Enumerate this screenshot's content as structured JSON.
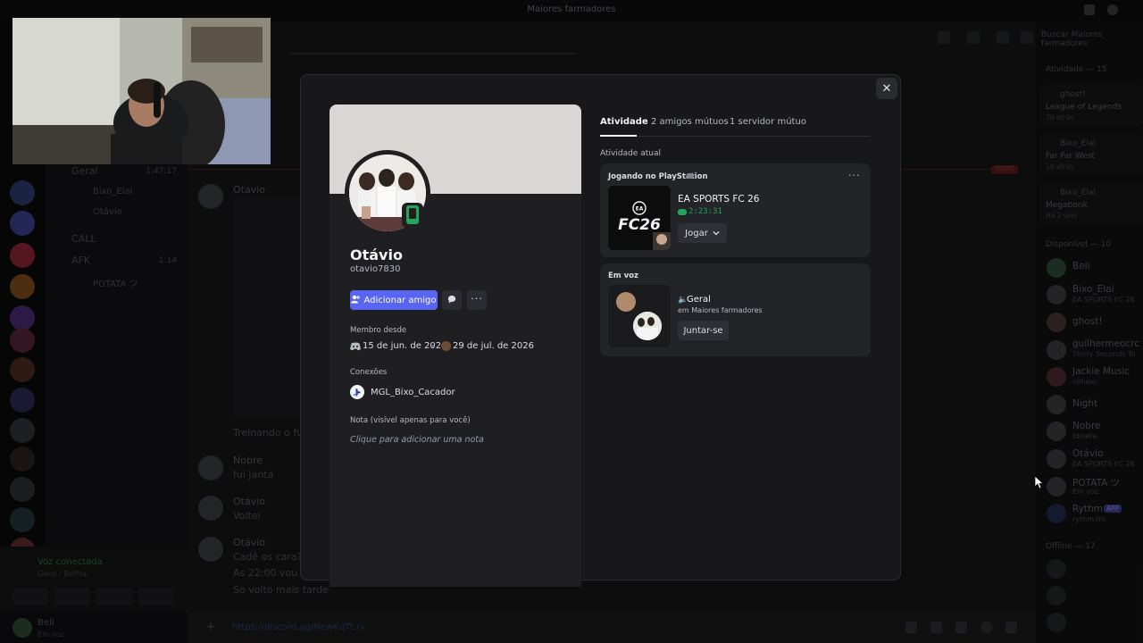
{
  "window": {
    "title": "Maiores farmadores"
  },
  "channels": [
    {
      "name": "Geral",
      "time": "1:47:17"
    },
    {
      "name": "Bixo_Elal"
    },
    {
      "name": "Otávio"
    },
    {
      "name": "CALL"
    },
    {
      "name": "AFK",
      "time": "1:14"
    },
    {
      "name": "POTATA ツ"
    }
  ],
  "voice_panel": {
    "status": "Voz conectada",
    "location": "Geral / Belfita"
  },
  "user_panel": {
    "name": "Beli",
    "status": "Em voz"
  },
  "chat": {
    "messages": [
      {
        "author": "Otávio",
        "text": ""
      },
      {
        "author": "",
        "text": "Treinando o futu"
      },
      {
        "author": "Nobre",
        "text": "fui janta"
      },
      {
        "author": "Otávio",
        "text": "Voltei"
      },
      {
        "author": "Otávio",
        "text": "Cadê os cara?"
      },
      {
        "author": "",
        "text": "As 22:00 vou sa"
      },
      {
        "author": "",
        "text": "So volto mais tarde"
      }
    ],
    "new_badge": "NOVO",
    "input_text": "https://discord.gg/NewKqTt.rv"
  },
  "search": {
    "placeholder": "Buscar Maiores farmadores"
  },
  "members": {
    "activity_header": "Atividade — 15",
    "activity": [
      {
        "name": "ghost!",
        "game": "League of Legends",
        "time": "3d atrás"
      },
      {
        "name": "Bixo_Elal",
        "game": "Far Far West",
        "time": "1d atrás"
      },
      {
        "name": "Bixo_Elal",
        "game": "Megabonk",
        "time": "Há 2 sem"
      }
    ],
    "online_header": "Disponível — 10",
    "online": [
      {
        "name": "Beli",
        "sub": ""
      },
      {
        "name": "Bixo_Elal",
        "sub": "EA SPORTS FC 26"
      },
      {
        "name": "ghost!",
        "sub": ""
      },
      {
        "name": "guilhermeocrc",
        "sub": "Thirty Seconds To"
      },
      {
        "name": "Jackie Music",
        "sub": "nilheio"
      },
      {
        "name": "Night",
        "sub": ""
      },
      {
        "name": "Nobre",
        "sub": "Idioeta"
      },
      {
        "name": "Otávio",
        "sub": "EA SPORTS FC 26"
      },
      {
        "name": "POTATA ツ",
        "sub": "Em voz"
      },
      {
        "name": "Rythm",
        "sub": "rythm.fm",
        "badge": "APP"
      }
    ],
    "offline_header": "Offline — 17"
  },
  "profile": {
    "display_name": "Otávio",
    "username": "otavio7830",
    "add_friend_label": "Adicionar amigo",
    "member_since_label": "Membro desde",
    "discord_since": "15 de jun. de 2020",
    "server_since": "29 de jul. de 2026",
    "connections_label": "Conexões",
    "connection_name": "MGL_Bixo_Cacador",
    "note_label": "Nota (visível apenas para você)",
    "note_placeholder": "Clique para adicionar uma nota"
  },
  "tabs": [
    "Atividade",
    "2 amigos mútuos",
    "1 servidor mútuo"
  ],
  "activity": {
    "current_label": "Atividade atual",
    "playing_header": "Jogando no PlayStation",
    "game_title": "EA SPORTS FC 26",
    "game_art": "FC26",
    "elapsed": "2:23:31",
    "play_button": "Jogar",
    "voice_header": "Em voz",
    "voice_channel": "Geral",
    "voice_server": "em Maiores farmadores",
    "join_button": "Juntar-se"
  },
  "colors": {
    "blurple": "#5865f2",
    "online": "#23a55a",
    "modal_bg": "#18181b",
    "card_bg": "#232428"
  }
}
